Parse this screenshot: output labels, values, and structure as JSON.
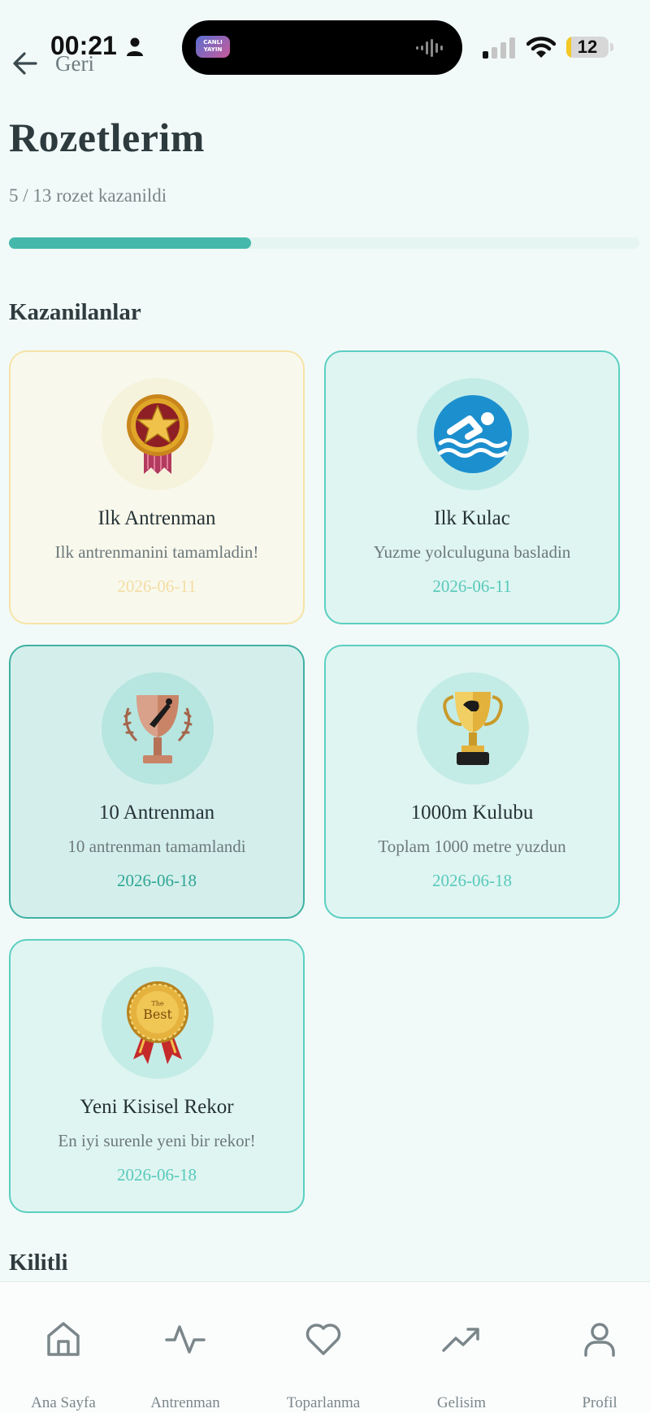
{
  "status_bar": {
    "time": "00:21",
    "battery": "12",
    "battery_level": 0.12,
    "live_badge": "CANLI YAYIN"
  },
  "nav": {
    "back_label": "Geri"
  },
  "header": {
    "title": "Rozetlerim",
    "progress_text": "5 / 13 rozet kazanildi",
    "earned_count": 5,
    "total_count": 13
  },
  "sections": {
    "earned_title": "Kazanilanlar",
    "locked_title": "Kilitli"
  },
  "badges": [
    {
      "title": "Ilk Antrenman",
      "description": "Ilk antrenmanini tamamladin!",
      "date": "2026-06-11",
      "icon": "gold-star-medal-icon"
    },
    {
      "title": "Ilk Kulac",
      "description": "Yuzme yolculuguna basladin",
      "date": "2026-06-11",
      "icon": "swimmer-icon"
    },
    {
      "title": "10 Antrenman",
      "description": "10 antrenman tamamlandi",
      "date": "2026-06-18",
      "icon": "bronze-trophy-icon"
    },
    {
      "title": "1000m Kulubu",
      "description": "Toplam 1000 metre yuzdun",
      "date": "2026-06-18",
      "icon": "gold-trophy-icon"
    },
    {
      "title": "Yeni Kisisel Rekor",
      "description": "En iyi surenle yeni bir rekor!",
      "date": "2026-06-18",
      "icon": "best-seal-icon",
      "icon_text_top": "The",
      "icon_text_main": "Best"
    }
  ],
  "bottom_nav": [
    {
      "label": "Ana Sayfa",
      "icon": "home-icon"
    },
    {
      "label": "Antrenman",
      "icon": "activity-icon"
    },
    {
      "label": "Toparlanma",
      "icon": "heart-icon"
    },
    {
      "label": "Gelisim",
      "icon": "trending-up-icon"
    },
    {
      "label": "Profil",
      "icon": "user-icon"
    }
  ],
  "colors": {
    "accent": "#45b8ab",
    "background": "#f1faf8",
    "card_teal": "#dff5f1",
    "card_gold": "#f8f9ec"
  }
}
